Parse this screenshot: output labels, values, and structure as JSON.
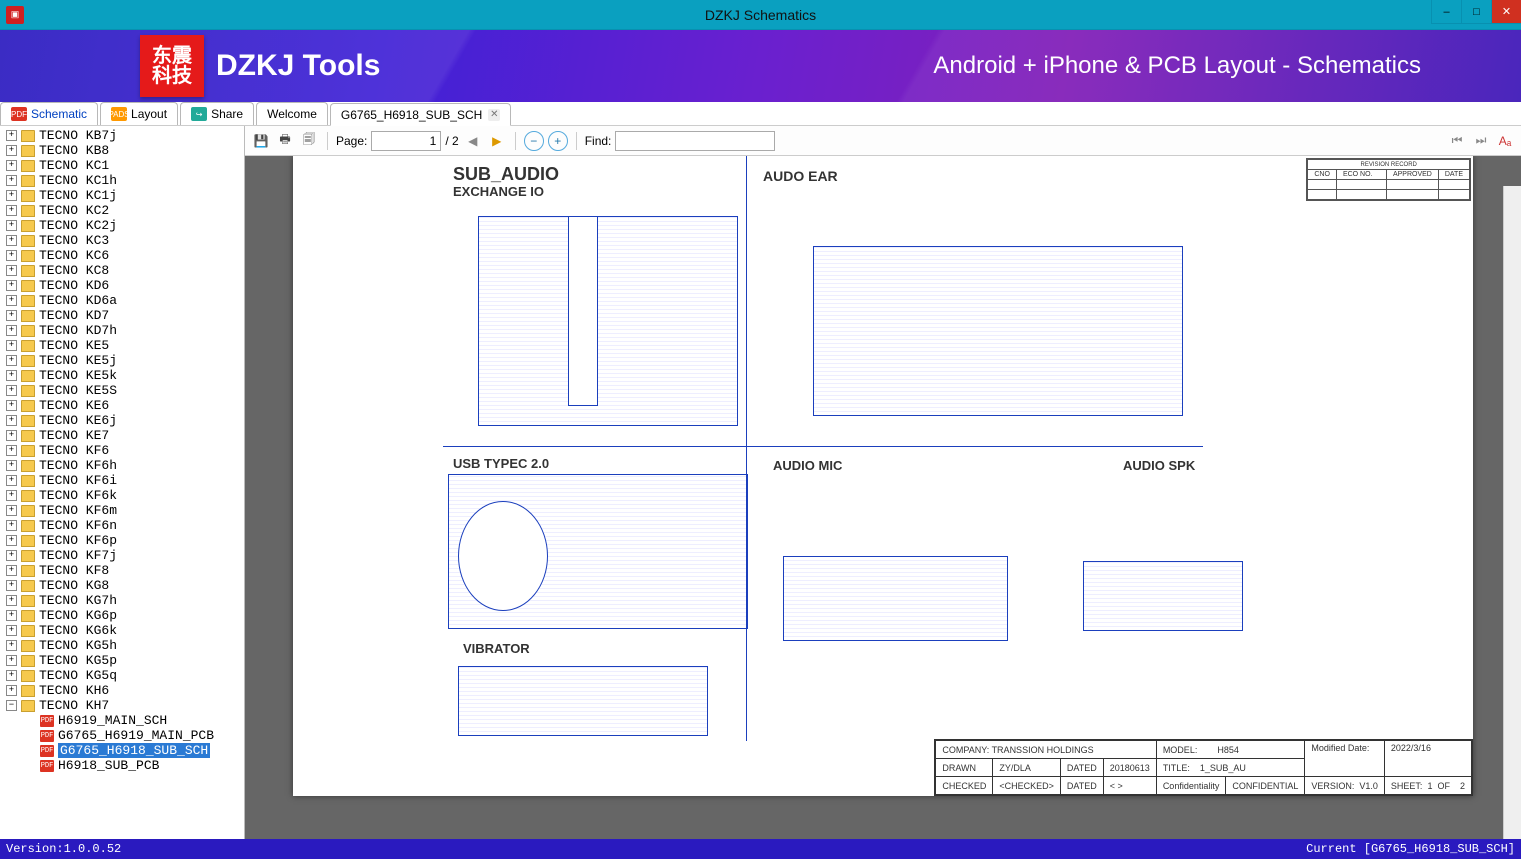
{
  "window": {
    "title": "DZKJ Schematics"
  },
  "banner": {
    "logo_lines": [
      "东震",
      "科技"
    ],
    "brand": "DZKJ Tools",
    "tagline": "Android + iPhone & PCB Layout - Schematics"
  },
  "tabs": {
    "schematic": "Schematic",
    "layout": "Layout",
    "share": "Share",
    "welcome": "Welcome",
    "doc": "G6765_H6918_SUB_SCH"
  },
  "tree": {
    "folders": [
      "TECNO KB7j",
      "TECNO KB8",
      "TECNO KC1",
      "TECNO KC1h",
      "TECNO KC1j",
      "TECNO KC2",
      "TECNO KC2j",
      "TECNO KC3",
      "TECNO KC6",
      "TECNO KC8",
      "TECNO KD6",
      "TECNO KD6a",
      "TECNO KD7",
      "TECNO KD7h",
      "TECNO KE5",
      "TECNO KE5j",
      "TECNO KE5k",
      "TECNO KE5S",
      "TECNO KE6",
      "TECNO KE6j",
      "TECNO KE7",
      "TECNO KF6",
      "TECNO KF6h",
      "TECNO KF6i",
      "TECNO KF6k",
      "TECNO KF6m",
      "TECNO KF6n",
      "TECNO KF6p",
      "TECNO KF7j",
      "TECNO KF8",
      "TECNO KG8",
      "TECNO KG7h",
      "TECNO KG6p",
      "TECNO KG6k",
      "TECNO KG5h",
      "TECNO KG5p",
      "TECNO KG5q",
      "TECNO KH6"
    ],
    "open_folder": "TECNO KH7",
    "files": [
      "H6919_MAIN_SCH",
      "G6765_H6919_MAIN_PCB",
      "G6765_H6918_SUB_SCH",
      "H6918_SUB_PCB"
    ],
    "selected_file_index": 2
  },
  "toolbar": {
    "page_label": "Page:",
    "page_value": "1",
    "page_total": "/ 2",
    "find_label": "Find:",
    "find_value": ""
  },
  "schematic": {
    "blocks": {
      "sub_audio": {
        "title": "SUB_AUDIO",
        "subtitle": "EXCHANGE IO"
      },
      "audo_ear": {
        "title": "AUDO EAR"
      },
      "usb": {
        "title": "USB TYPEC 2.0"
      },
      "vibrator": {
        "title": "VIBRATOR"
      },
      "audio_mic": {
        "title": "AUDIO MIC"
      },
      "audio_spk": {
        "title": "AUDIO SPK"
      }
    },
    "revision_header": [
      "CNO",
      "ECO NO.",
      "APPROVED",
      "DATE"
    ],
    "title_block": {
      "company_label": "COMPANY:",
      "company": "TRANSSION HOLDINGS",
      "model_label": "MODEL:",
      "model": "H854",
      "moddate_label": "Modified Date:",
      "moddate": "2022/3/16",
      "drawn_label": "DRAWN",
      "drawn": "ZY/DLA",
      "dated1_label": "DATED",
      "dated1": "20180613",
      "title_label": "TITLE:",
      "title": "1_SUB_AU",
      "version_label": "VERSION:",
      "version": "V1.0",
      "sheet_label": "SHEET:",
      "sheet": "1",
      "of_label": "OF",
      "sheet_total": "2",
      "checked_label": "CHECKED",
      "checked": "<CHECKED>",
      "dated2_label": "DATED",
      "dated2": "<   >",
      "conf_label": "Confidentiality",
      "conf": "CONFIDENTIAL"
    }
  },
  "status": {
    "version_label": "Version:1.0.0.52",
    "current": "Current [G6765_H6918_SUB_SCH]"
  }
}
